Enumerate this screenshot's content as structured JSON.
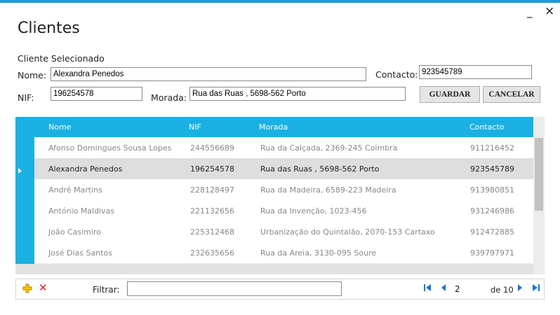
{
  "window": {
    "minimize_glyph": "_",
    "close_glyph": "×"
  },
  "title": "Clientes",
  "form": {
    "section_label": "Cliente Selecionado",
    "nome_label": "Nome:",
    "nome_value": "Alexandra Penedos",
    "contacto_label": "Contacto:",
    "contacto_value": "923545789",
    "nif_label": "NIF:",
    "nif_value": "196254578",
    "morada_label": "Morada:",
    "morada_value": "Rua das Ruas , 5698-562 Porto",
    "guardar_label": "GUARDAR",
    "cancelar_label": "CANCELAR"
  },
  "table": {
    "columns": [
      "Nome",
      "NIF",
      "Morada",
      "Contacto"
    ],
    "rows": [
      [
        "Afonso Domingues Sousa Lopes",
        "244556689",
        "Rua da Calçada, 2369-245 Coimbra",
        "911216452"
      ],
      [
        "Alexandra Penedos",
        "196254578",
        "Rua das Ruas , 5698-562 Porto",
        "923545789"
      ],
      [
        "André Martins",
        "228128497",
        "Rua da Madeira, 6589-223 Madeira",
        "913980851"
      ],
      [
        "António Maldivas",
        "221132656",
        "Rua da Invenção, 1023-456",
        "931246986"
      ],
      [
        "João Casimiro",
        "225312468",
        "Urbanização do Quintalão, 2070-153 Cartaxo",
        "912472885"
      ],
      [
        "José Dias Santos",
        "232635656",
        "Rua da Areia, 3130-095 Soure",
        "939797971"
      ]
    ],
    "selected_row": 1
  },
  "toolbar": {
    "add_icon": "plus-icon",
    "delete_icon": "delete-x-icon",
    "filter_label": "Filtrar:",
    "filter_value": "",
    "page_value": "2",
    "page_of": "de 10"
  },
  "colors": {
    "accent": "#1ab1e2",
    "selected_row": "#dedede",
    "nav_icon": "#1776d6",
    "delete": "#e02020",
    "add": "#e8b400"
  }
}
